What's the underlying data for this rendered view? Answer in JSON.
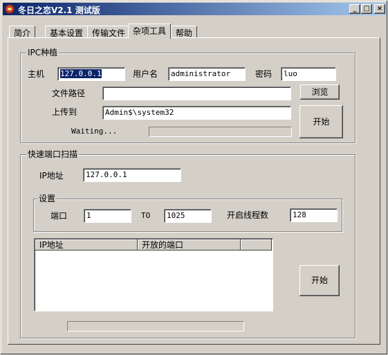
{
  "window": {
    "title": "冬日之恋V2.1  测试版"
  },
  "titlebar_buttons": {
    "minimize": "_",
    "maximize": "□",
    "close": "×"
  },
  "tabs": [
    {
      "label": "简介"
    },
    {
      "label": "基本设置"
    },
    {
      "label": "传输文件"
    },
    {
      "label": "杂项工具",
      "active": true
    },
    {
      "label": "帮助"
    }
  ],
  "ipc": {
    "group_title": "IPC种植",
    "host_label": "主机",
    "host_value": "127.0.0.1",
    "user_label": "用户名",
    "user_value": "administrator",
    "password_label": "密码",
    "password_value": "luo",
    "filepath_label": "文件路径",
    "filepath_value": "",
    "browse_button": "浏览",
    "upload_label": "上传到",
    "upload_value": "Admin$\\system32",
    "status_text": "Waiting...",
    "progress": 0,
    "start_button": "开始"
  },
  "scan": {
    "group_title": "快速端口扫描",
    "ip_label": "IP地址",
    "ip_value": "127.0.0.1",
    "settings_title": "设置",
    "port_label": "端口",
    "port_from": "1",
    "to_label": "TO",
    "port_to": "1025",
    "threads_label": "开启线程数",
    "threads_value": "128",
    "columns": [
      "IP地址",
      "开放的端口",
      ""
    ],
    "start_button": "开始",
    "progress": 0
  },
  "colors": {
    "face": "#d4d0c8",
    "title_start": "#0a246a",
    "title_end": "#a6caf0"
  }
}
